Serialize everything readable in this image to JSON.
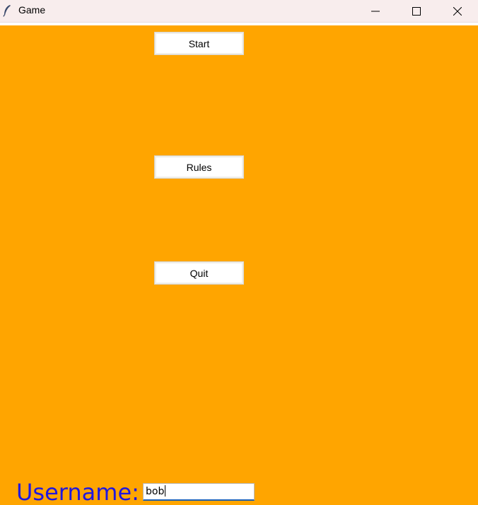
{
  "window": {
    "title": "Game",
    "icon": "feather-icon",
    "controls": [
      "minimize",
      "maximize",
      "close"
    ]
  },
  "colors": {
    "background": "#ffa500",
    "label": "#1f17e0",
    "input_underline": "#1a5fb4"
  },
  "menu": {
    "start_label": "Start",
    "rules_label": "Rules",
    "quit_label": "Quit"
  },
  "username": {
    "label": "Username:",
    "value": "bob"
  }
}
